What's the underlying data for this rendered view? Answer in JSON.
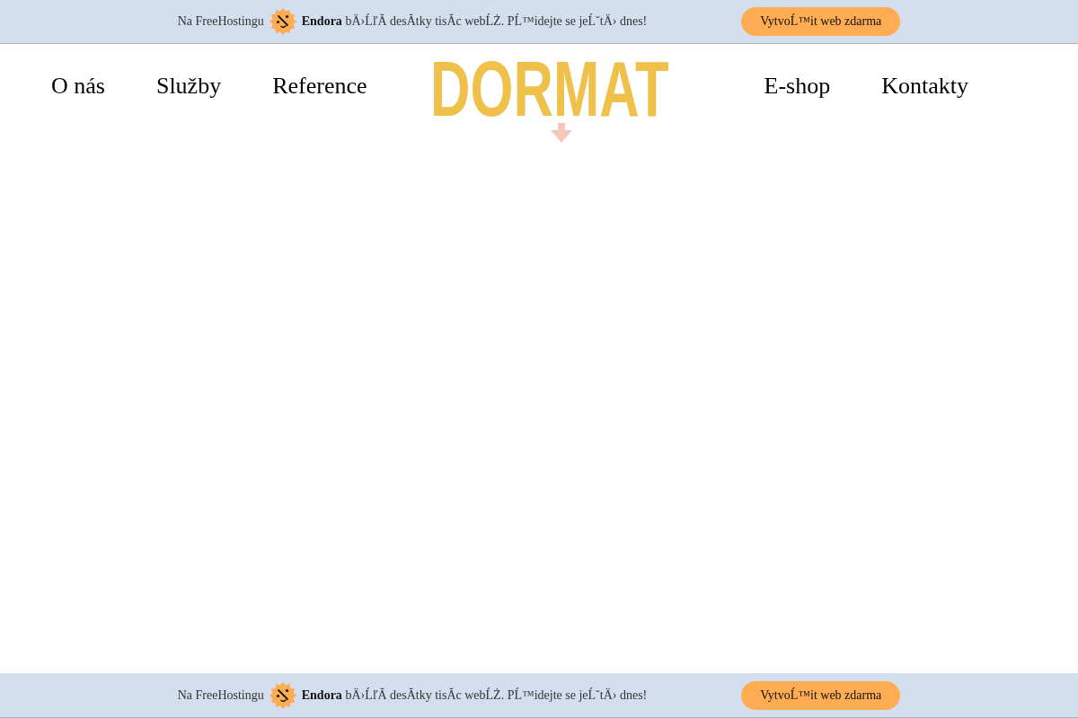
{
  "top_banner": {
    "intro": "Na FreeHostingu",
    "message": "**Endora** bÄ›ĹľĂ desĂtky tisĂc webĹŻ. PĹ™idejte se jeĹˇtÄ› dnes!",
    "button": "VytvoĹ™it web zdarma"
  },
  "nav": {
    "left_items": [
      "O nás",
      "Služby",
      "Reference"
    ],
    "logo": "DORMAT",
    "right_items": [
      "E-shop",
      "Kontakty"
    ]
  },
  "bottom_banner": {
    "intro": "Na FreeHostingu",
    "message": "**Endora** bÄ›ĹľĂ desĂtky tisĂc webĹŻ. PĹ™idejte se jeĹˇtÄ› dnes!",
    "button": "VytvoĹ™it web zdarma"
  }
}
